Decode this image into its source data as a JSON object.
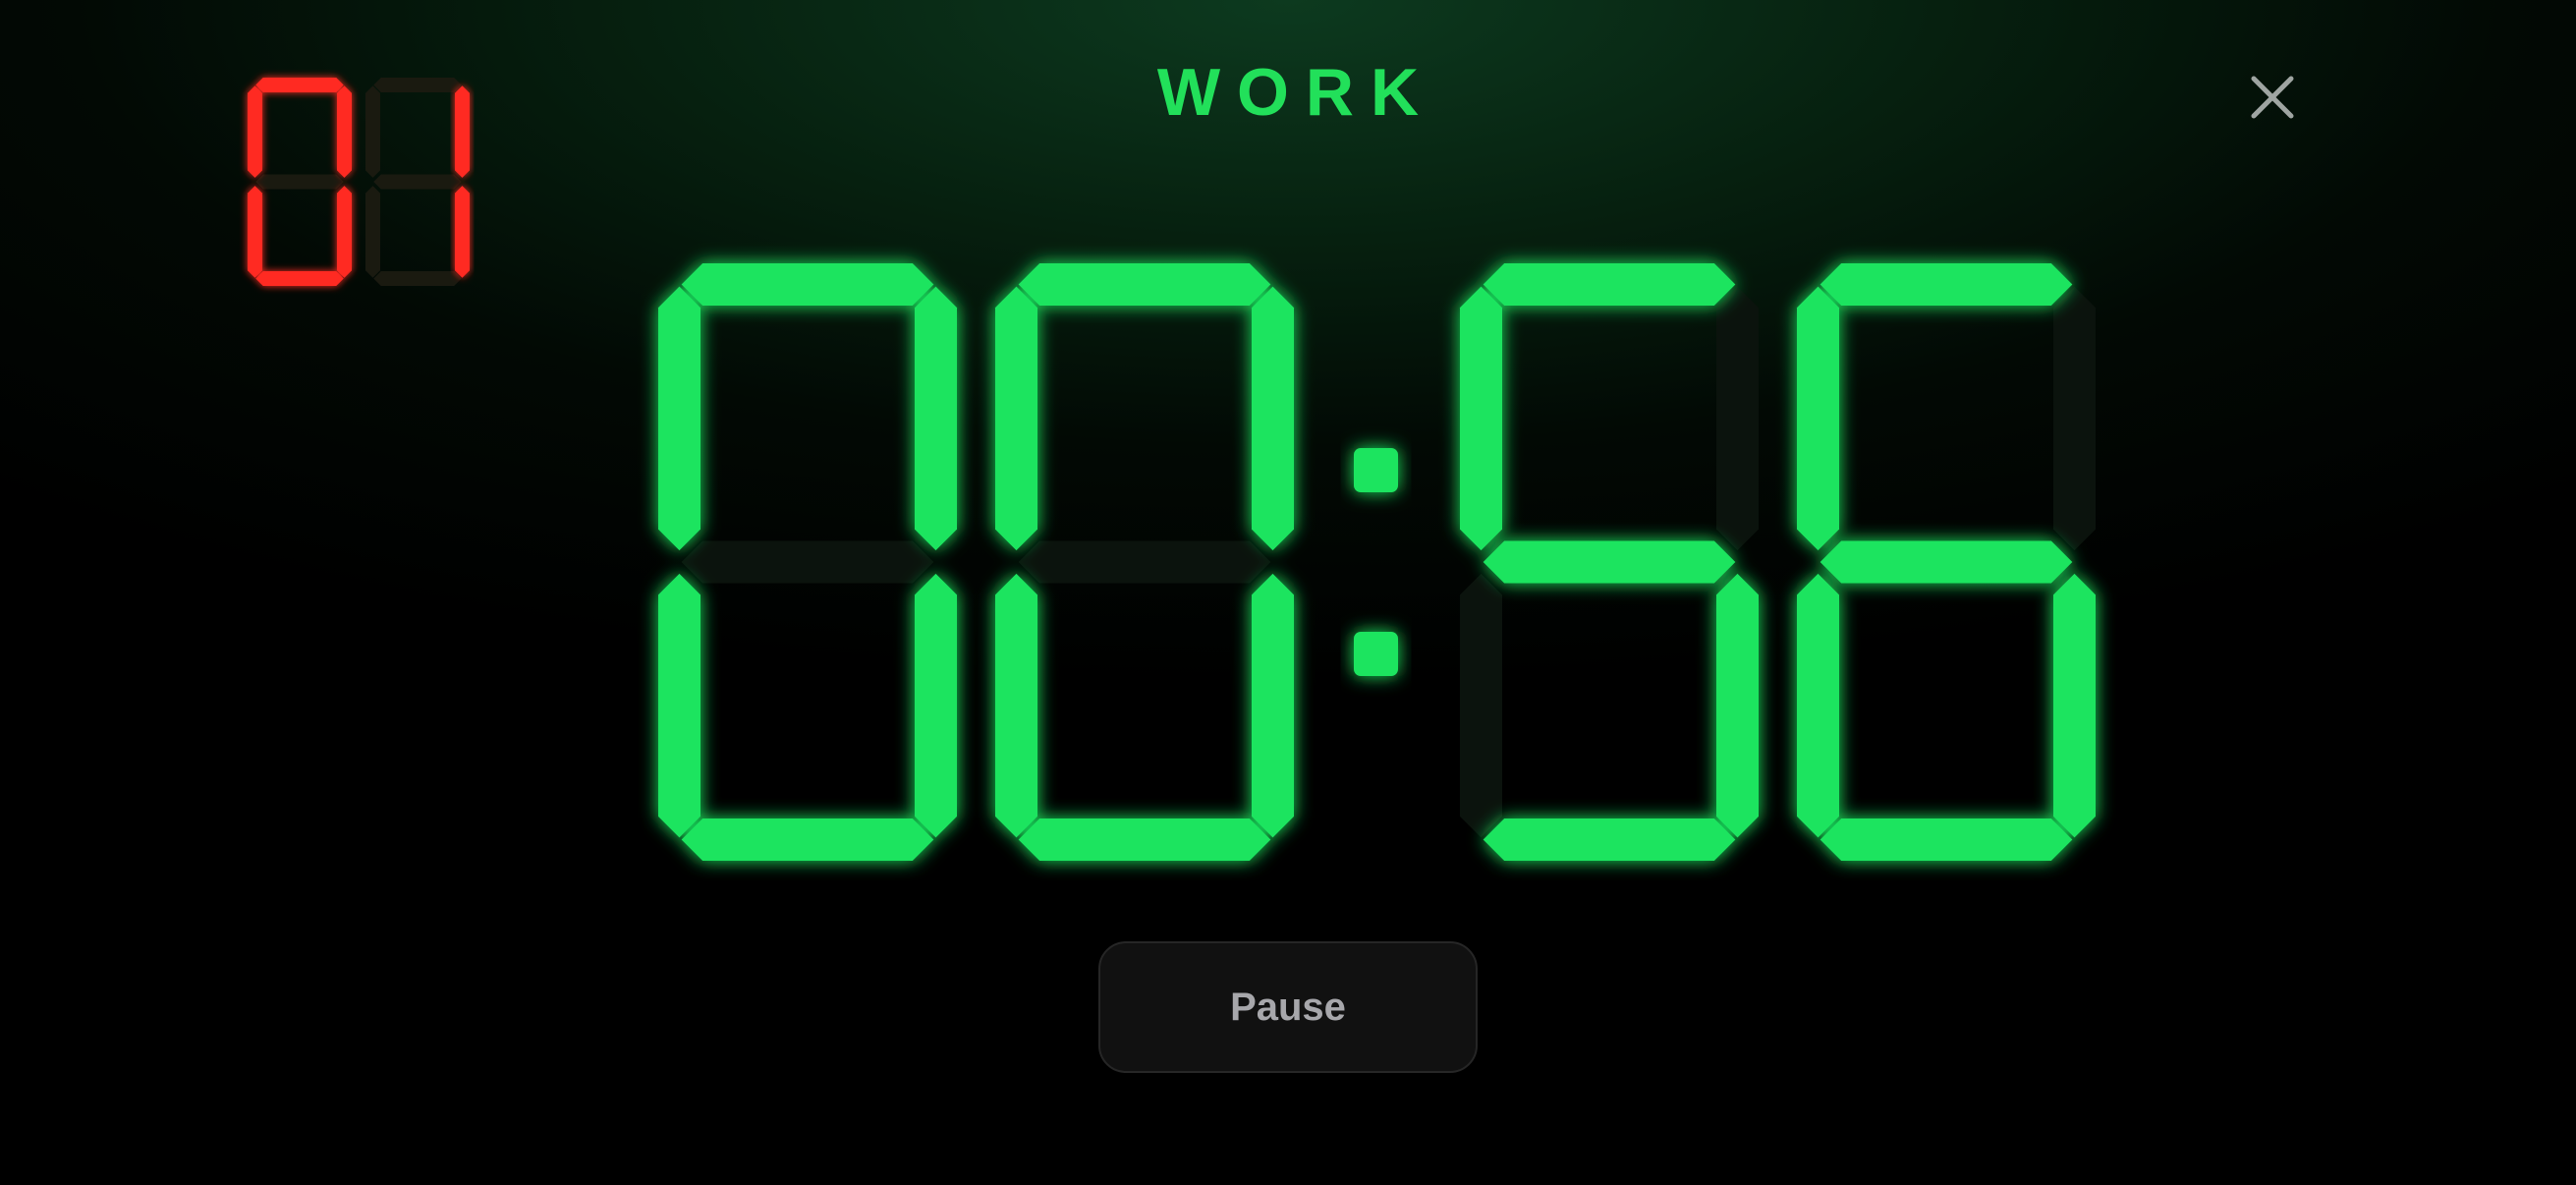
{
  "app": {
    "mode_label": "WORK",
    "close_icon": "close-icon",
    "pause_label": "Pause"
  },
  "round": {
    "value": "01",
    "color_on": "#ff2a22",
    "color_off": "#1a1a10"
  },
  "timer": {
    "minutes": "00",
    "seconds": "56",
    "separator": ":",
    "color_on": "#1de45f",
    "color_off": "#0b130d"
  },
  "colors": {
    "background_top": "#0d3a1f",
    "background_bottom": "#000000",
    "label": "#22e05a",
    "button_bg": "#111111",
    "button_text": "#a7a7ab",
    "close_icon": "#9fa5a2"
  }
}
